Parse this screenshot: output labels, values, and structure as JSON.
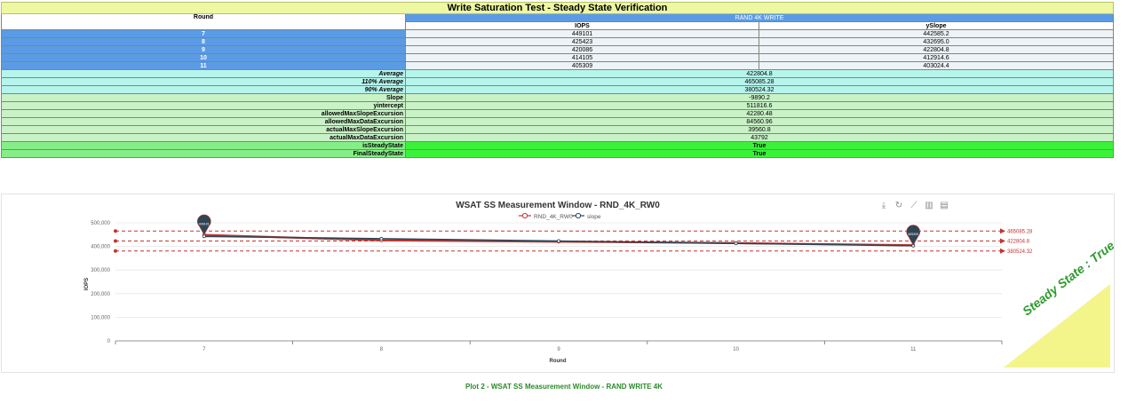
{
  "table": {
    "title": "Write Saturation Test - Steady State Verification",
    "round_header": "Round",
    "group_header": "RAND 4K WRITE",
    "col_iops": "IOPS",
    "col_yslope": "ySlope",
    "rows": [
      {
        "round": "7",
        "iops": "449101",
        "yslope": "442585.2"
      },
      {
        "round": "8",
        "iops": "425423",
        "yslope": "432695.0"
      },
      {
        "round": "9",
        "iops": "420086",
        "yslope": "422804.8"
      },
      {
        "round": "10",
        "iops": "414105",
        "yslope": "412914.6"
      },
      {
        "round": "11",
        "iops": "405309",
        "yslope": "403024.4"
      }
    ],
    "average_label": "Average",
    "average_value": "422804.8",
    "avg110_label": "110% Average",
    "avg110_value": "465085.28",
    "avg90_label": "90% Average",
    "avg90_value": "380524.32",
    "slope_label": "Slope",
    "slope_value": "-9890.2",
    "yintercept_label": "yintercept",
    "yintercept_value": "511816.6",
    "allowed_slope_label": "allowedMaxSlopeExcursion",
    "allowed_slope_value": "42280.48",
    "allowed_data_label": "allowedMaxDataExcursion",
    "allowed_data_value": "84560.96",
    "actual_slope_label": "actualMaxSlopeExcursion",
    "actual_slope_value": "39560.8",
    "actual_data_label": "actualMaxDataExcursion",
    "actual_data_value": "43792",
    "is_ss_label": "isSteadyState",
    "is_ss_value": "True",
    "final_ss_label": "FinalSteadyState",
    "final_ss_value": "True"
  },
  "chart_data": {
    "type": "line",
    "title": "WSAT SS Measurement Window - RND_4K_RW0",
    "xlabel": "Round",
    "ylabel": "IOPS",
    "categories": [
      "7",
      "8",
      "9",
      "10",
      "11"
    ],
    "ylim": [
      0,
      500000
    ],
    "yticks": [
      "0",
      "100,000",
      "200,000",
      "300,000",
      "400,000",
      "500,000"
    ],
    "ytick_values": [
      0,
      100000,
      200000,
      300000,
      400000,
      500000
    ],
    "grid": true,
    "legend_position": "top-center",
    "series": [
      {
        "name": "RND_4K_RW0",
        "values": [
          449101,
          425423,
          420086,
          414105,
          405309
        ],
        "color": "#c23531"
      },
      {
        "name": "slope",
        "values": [
          442585.2,
          432695.0,
          422804.8,
          412914.6,
          403024.4
        ],
        "color": "#2f4554"
      }
    ],
    "markpoints": [
      {
        "label": "449101",
        "category": "7",
        "value": 449101
      },
      {
        "label": "405309",
        "category": "11",
        "value": 405309
      }
    ],
    "reference_lines": [
      {
        "label": "465085.28",
        "value": 465085.28
      },
      {
        "label": "422804.8",
        "value": 422804.8
      },
      {
        "label": "380524.32",
        "value": 380524.32
      }
    ]
  },
  "toolbox": [
    "download-icon",
    "refresh-icon",
    "line-chart-icon",
    "bar-chart-icon",
    "data-view-icon"
  ],
  "stamp_text": "Steady State : True",
  "caption": "Plot 2 - WSAT SS Measurement Window - RAND WRITE 4K"
}
